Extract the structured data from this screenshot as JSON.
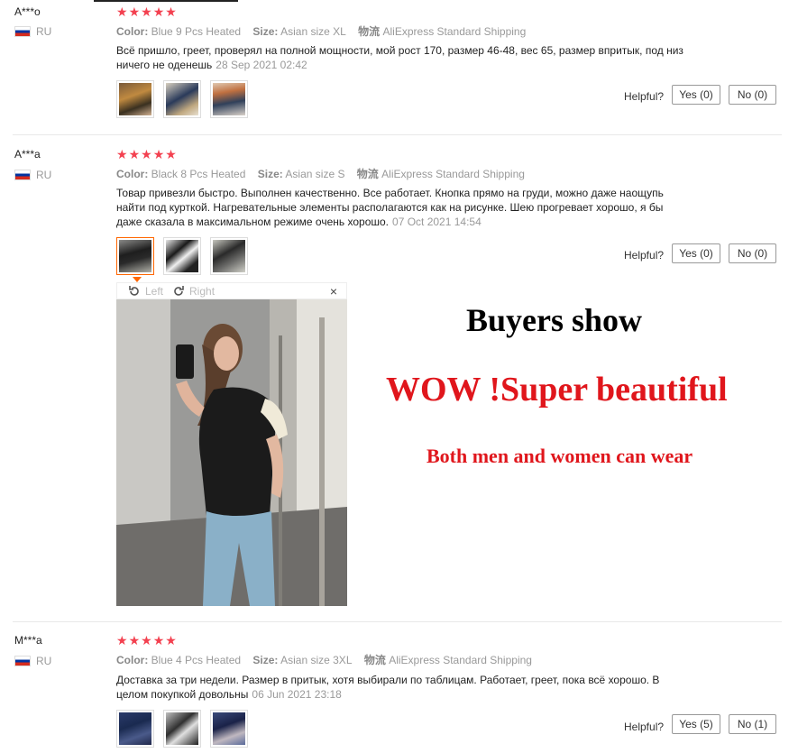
{
  "reviews": [
    {
      "user": "A***o",
      "country": "RU",
      "stars": 5,
      "color_label": "Color:",
      "color_value": "Blue 9 Pcs Heated",
      "size_label": "Size:",
      "size_value": "Asian size XL",
      "ship_label": "物流",
      "ship_value": "AliExpress Standard Shipping",
      "text": "Всё пришло, греет, проверял на полной мощности, мой рост 170, размер 46-48, вес 65, размер впритык, под низ ничего не оденешь",
      "date": "28 Sep 2021 02:42",
      "helpful_label": "Helpful?",
      "yes_label": "Yes (0)",
      "no_label": "No (0)"
    },
    {
      "user": "A***a",
      "country": "RU",
      "stars": 5,
      "color_label": "Color:",
      "color_value": "Black 8 Pcs Heated",
      "size_label": "Size:",
      "size_value": "Asian size S",
      "ship_label": "物流",
      "ship_value": "AliExpress Standard Shipping",
      "text": "Товар привезли быстро. Выполнен качественно. Все работает. Кнопка прямо на груди, можно даже наощупь найти под курткой. Нагревательные элементы располагаются как на рисунке. Шею прогревает хорошо, я бы даже сказала в максимальном режиме очень хорошо.",
      "date": "07 Oct 2021 14:54",
      "helpful_label": "Helpful?",
      "yes_label": "Yes (0)",
      "no_label": "No (0)"
    },
    {
      "user": "M***a",
      "country": "RU",
      "stars": 5,
      "color_label": "Color:",
      "color_value": "Blue 4 Pcs Heated",
      "size_label": "Size:",
      "size_value": "Asian size 3XL",
      "ship_label": "物流",
      "ship_value": "AliExpress Standard Shipping",
      "text": "Доставка за три недели. Размер в притык, хотя выбирали по таблицам. Работает, греет, пока всё хорошо. В целом покупкой довольны",
      "date": "06 Jun 2021 23:18",
      "helpful_label": "Helpful?",
      "yes_label": "Yes (5)",
      "no_label": "No (1)"
    }
  ],
  "viewer": {
    "left_label": "Left",
    "right_label": "Right",
    "close_label": "×"
  },
  "promo": {
    "line1": "Buyers show",
    "line2": "WOW !Super beautiful",
    "line3": "Both men and women can wear"
  },
  "colors": {
    "star": "#f34150",
    "promo_red": "#e0161c",
    "active_thumb": "#ff6600"
  }
}
